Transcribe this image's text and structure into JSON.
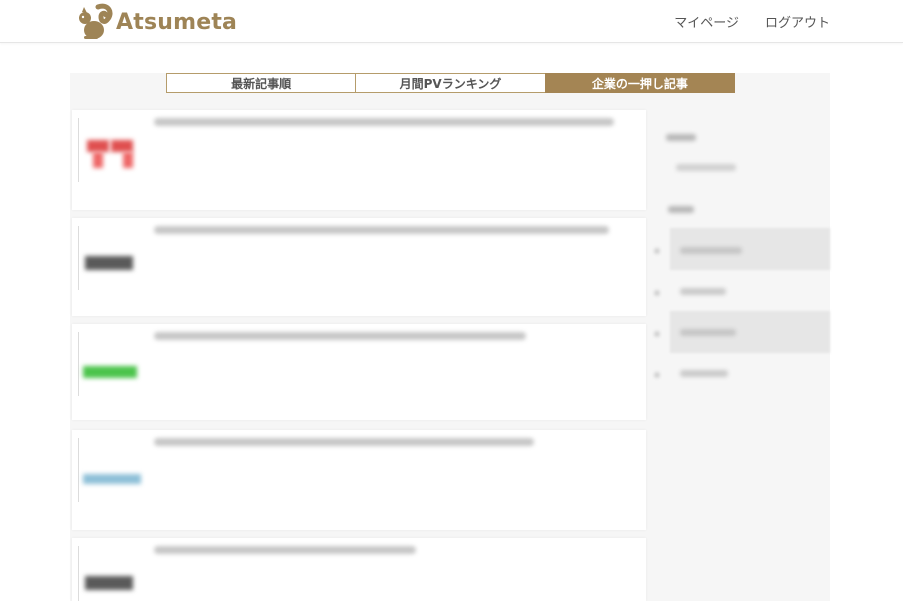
{
  "brand": {
    "name": "Atsumeta",
    "color": "#9e8456"
  },
  "nav": {
    "mypage": "マイページ",
    "logout": "ログアウト"
  },
  "tabs": [
    {
      "label": "最新記事順",
      "active": false
    },
    {
      "label": "月間PVランキング",
      "active": false
    },
    {
      "label": "企業の一押し記事",
      "active": true
    }
  ],
  "accent_color": "#a48554",
  "articles": [
    {
      "thumb_color": "#e05050"
    },
    {
      "thumb_color": "#5a5a5a"
    },
    {
      "thumb_color": "#4cc44c"
    },
    {
      "thumb_color": "#8ec0d8"
    },
    {
      "thumb_color": "#5a5a5a"
    }
  ]
}
